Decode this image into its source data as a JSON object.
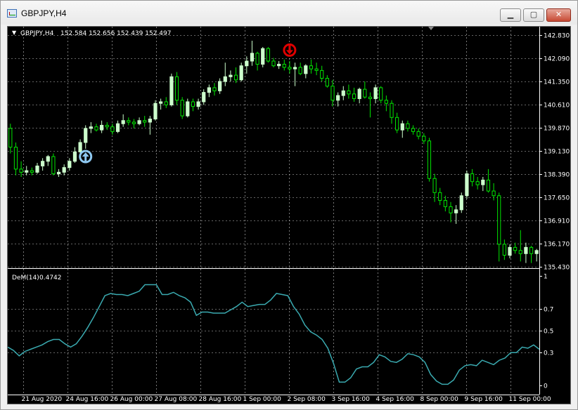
{
  "window": {
    "title": "GBPJPY,H4",
    "buttons": {
      "minimize": "▁",
      "maximize": "▢",
      "close": "✕"
    }
  },
  "main_header": {
    "symbol": "GBPJPY,H4",
    "ohlc": "152.584 152.656 152.439 152.497",
    "marker": "▼"
  },
  "indicator_header": {
    "name": "DeM(14)",
    "value": "0.4742"
  },
  "colors": {
    "background": "#000000",
    "grid": "#c8c8c8",
    "candle_up": "#ccffcc",
    "candle_down": "#00e600",
    "dem_line": "#3aaab0",
    "text": "#ffffff",
    "buy_arrow": "#8ec8f0",
    "sell_arrow": "#e00000"
  },
  "chart_data": [
    {
      "type": "candlestick",
      "price_labels": [
        "142.830",
        "142.090",
        "141.350",
        "140.610",
        "139.870",
        "139.130",
        "138.390",
        "137.650",
        "136.910",
        "136.170",
        "135.430"
      ],
      "ylim": [
        135.43,
        142.83
      ],
      "x_labels": [
        "21 Aug 2020",
        "24 Aug 16:00",
        "26 Aug 00:00",
        "27 Aug 08:00",
        "28 Aug 16:00",
        "1 Sep 00:00",
        "2 Sep 08:00",
        "3 Sep 16:00",
        "4 Sep 16:00",
        "8 Sep 00:00",
        "9 Sep 16:00",
        "11 Sep 00:00"
      ],
      "candles": [
        [
          139.85,
          140.0,
          139.05,
          139.25
        ],
        [
          139.25,
          139.4,
          138.35,
          138.55
        ],
        [
          138.55,
          138.8,
          138.3,
          138.45
        ],
        [
          138.45,
          138.65,
          138.35,
          138.5
        ],
        [
          138.5,
          138.6,
          138.35,
          138.45
        ],
        [
          138.45,
          138.75,
          138.4,
          138.65
        ],
        [
          138.65,
          138.9,
          138.5,
          138.8
        ],
        [
          138.8,
          139.0,
          138.65,
          138.95
        ],
        [
          138.95,
          139.05,
          138.35,
          138.4
        ],
        [
          138.4,
          138.55,
          138.3,
          138.45
        ],
        [
          138.45,
          138.7,
          138.35,
          138.6
        ],
        [
          138.6,
          138.9,
          138.5,
          138.8
        ],
        [
          138.8,
          139.25,
          138.75,
          139.1
        ],
        [
          139.1,
          139.5,
          139.0,
          139.4
        ],
        [
          139.4,
          139.95,
          139.2,
          139.85
        ],
        [
          139.85,
          140.05,
          139.7,
          139.9
        ],
        [
          139.9,
          140.0,
          139.75,
          139.8
        ],
        [
          139.8,
          140.1,
          139.7,
          139.95
        ],
        [
          139.95,
          140.05,
          139.8,
          139.9
        ],
        [
          139.9,
          140.0,
          139.65,
          139.75
        ],
        [
          139.75,
          140.1,
          139.7,
          140.0
        ],
        [
          140.0,
          140.3,
          139.9,
          140.1
        ],
        [
          140.1,
          140.2,
          139.95,
          140.05
        ],
        [
          140.05,
          140.15,
          139.85,
          140.0
        ],
        [
          140.0,
          140.2,
          139.95,
          140.1
        ],
        [
          140.1,
          140.25,
          139.9,
          140.05
        ],
        [
          140.05,
          140.25,
          139.65,
          140.15
        ],
        [
          140.15,
          140.75,
          140.1,
          140.65
        ],
        [
          140.65,
          140.8,
          140.45,
          140.7
        ],
        [
          140.7,
          140.85,
          140.5,
          140.6
        ],
        [
          140.6,
          141.6,
          140.55,
          141.5
        ],
        [
          141.5,
          141.65,
          140.6,
          140.75
        ],
        [
          140.75,
          140.85,
          140.15,
          140.25
        ],
        [
          140.25,
          140.8,
          140.2,
          140.7
        ],
        [
          140.7,
          140.8,
          140.4,
          140.55
        ],
        [
          140.55,
          140.8,
          140.45,
          140.7
        ],
        [
          140.7,
          141.1,
          140.6,
          141.0
        ],
        [
          141.0,
          141.25,
          140.85,
          141.15
        ],
        [
          141.15,
          141.3,
          140.9,
          141.05
        ],
        [
          141.05,
          141.45,
          140.95,
          141.35
        ],
        [
          141.35,
          141.95,
          141.2,
          141.5
        ],
        [
          141.5,
          141.7,
          141.35,
          141.55
        ],
        [
          141.55,
          141.8,
          141.3,
          141.4
        ],
        [
          141.4,
          141.95,
          141.35,
          141.85
        ],
        [
          141.85,
          142.15,
          141.6,
          142.0
        ],
        [
          142.0,
          142.65,
          141.85,
          142.25
        ],
        [
          142.25,
          142.3,
          141.7,
          141.9
        ],
        [
          141.9,
          142.45,
          141.8,
          142.4
        ],
        [
          142.4,
          142.45,
          141.95,
          142.0
        ],
        [
          142.0,
          142.1,
          141.8,
          141.85
        ],
        [
          141.85,
          142.0,
          141.75,
          141.9
        ],
        [
          141.9,
          142.05,
          141.7,
          141.8
        ],
        [
          141.8,
          142.0,
          141.6,
          141.75
        ],
        [
          141.75,
          141.95,
          141.2,
          141.8
        ],
        [
          141.8,
          141.95,
          141.55,
          141.6
        ],
        [
          141.6,
          141.9,
          141.45,
          141.85
        ],
        [
          141.85,
          142.05,
          141.6,
          141.75
        ],
        [
          141.75,
          141.95,
          141.55,
          141.7
        ],
        [
          141.7,
          141.85,
          141.35,
          141.45
        ],
        [
          141.45,
          141.55,
          141.15,
          141.2
        ],
        [
          141.2,
          141.4,
          140.55,
          140.75
        ],
        [
          140.75,
          141.0,
          140.55,
          140.9
        ],
        [
          140.9,
          141.2,
          140.75,
          141.05
        ],
        [
          141.05,
          141.25,
          140.8,
          140.95
        ],
        [
          140.95,
          141.15,
          140.7,
          140.8
        ],
        [
          140.8,
          141.15,
          140.65,
          141.1
        ],
        [
          141.1,
          141.35,
          140.8,
          140.85
        ],
        [
          140.85,
          141.0,
          140.2,
          140.8
        ],
        [
          140.8,
          141.25,
          140.65,
          141.15
        ],
        [
          141.15,
          141.2,
          140.65,
          140.75
        ],
        [
          140.75,
          140.9,
          140.4,
          140.65
        ],
        [
          140.65,
          140.75,
          140.0,
          140.2
        ],
        [
          140.2,
          140.35,
          139.7,
          139.8
        ],
        [
          139.8,
          140.1,
          139.55,
          140.0
        ],
        [
          140.0,
          140.1,
          139.75,
          139.85
        ],
        [
          139.85,
          139.95,
          139.65,
          139.75
        ],
        [
          139.75,
          139.85,
          139.5,
          139.6
        ],
        [
          139.6,
          139.7,
          139.35,
          139.45
        ],
        [
          139.45,
          139.55,
          138.15,
          138.25
        ],
        [
          138.25,
          138.4,
          137.5,
          137.8
        ],
        [
          137.8,
          137.95,
          137.4,
          137.55
        ],
        [
          137.55,
          137.7,
          137.2,
          137.35
        ],
        [
          137.35,
          137.5,
          136.85,
          137.15
        ],
        [
          137.15,
          137.4,
          136.8,
          137.25
        ],
        [
          137.25,
          137.8,
          137.15,
          137.7
        ],
        [
          137.7,
          138.5,
          137.6,
          138.4
        ],
        [
          138.4,
          138.55,
          138.0,
          138.15
        ],
        [
          138.15,
          138.3,
          137.9,
          138.05
        ],
        [
          138.05,
          138.3,
          137.85,
          138.2
        ],
        [
          138.2,
          138.55,
          137.8,
          137.85
        ],
        [
          137.85,
          138.1,
          137.55,
          137.7
        ],
        [
          137.7,
          137.8,
          135.6,
          136.15
        ],
        [
          136.15,
          136.3,
          135.65,
          135.8
        ],
        [
          135.8,
          136.15,
          135.7,
          136.05
        ],
        [
          136.05,
          136.2,
          135.85,
          135.95
        ],
        [
          135.95,
          136.6,
          135.6,
          135.85
        ],
        [
          135.85,
          136.2,
          135.55,
          136.05
        ],
        [
          136.05,
          136.1,
          135.55,
          135.85
        ],
        [
          135.85,
          136.0,
          135.6,
          135.95
        ]
      ],
      "signals": [
        {
          "kind": "buy-arrow",
          "index": 14,
          "price": 138.95
        },
        {
          "kind": "sell-arrow",
          "index": 52,
          "price": 142.35
        }
      ]
    },
    {
      "type": "line",
      "name": "DeM(14)",
      "level_labels": [
        "1",
        "0.7",
        "0.5",
        "0.3",
        "0"
      ],
      "ylim": [
        0,
        1
      ],
      "values": [
        0.35,
        0.32,
        0.27,
        0.31,
        0.33,
        0.35,
        0.37,
        0.4,
        0.42,
        0.42,
        0.38,
        0.35,
        0.38,
        0.45,
        0.53,
        0.62,
        0.72,
        0.82,
        0.84,
        0.83,
        0.83,
        0.82,
        0.84,
        0.86,
        0.92,
        0.92,
        0.92,
        0.83,
        0.83,
        0.85,
        0.82,
        0.8,
        0.76,
        0.64,
        0.67,
        0.67,
        0.66,
        0.66,
        0.66,
        0.69,
        0.72,
        0.76,
        0.72,
        0.73,
        0.74,
        0.74,
        0.78,
        0.84,
        0.83,
        0.82,
        0.72,
        0.65,
        0.55,
        0.49,
        0.46,
        0.42,
        0.34,
        0.2,
        0.03,
        0.03,
        0.07,
        0.15,
        0.17,
        0.17,
        0.21,
        0.28,
        0.26,
        0.22,
        0.21,
        0.24,
        0.29,
        0.28,
        0.26,
        0.21,
        0.1,
        0.04,
        0.01,
        0.01,
        0.05,
        0.14,
        0.18,
        0.19,
        0.18,
        0.23,
        0.21,
        0.19,
        0.23,
        0.25,
        0.3,
        0.3,
        0.35,
        0.34,
        0.37,
        0.33
      ]
    }
  ]
}
